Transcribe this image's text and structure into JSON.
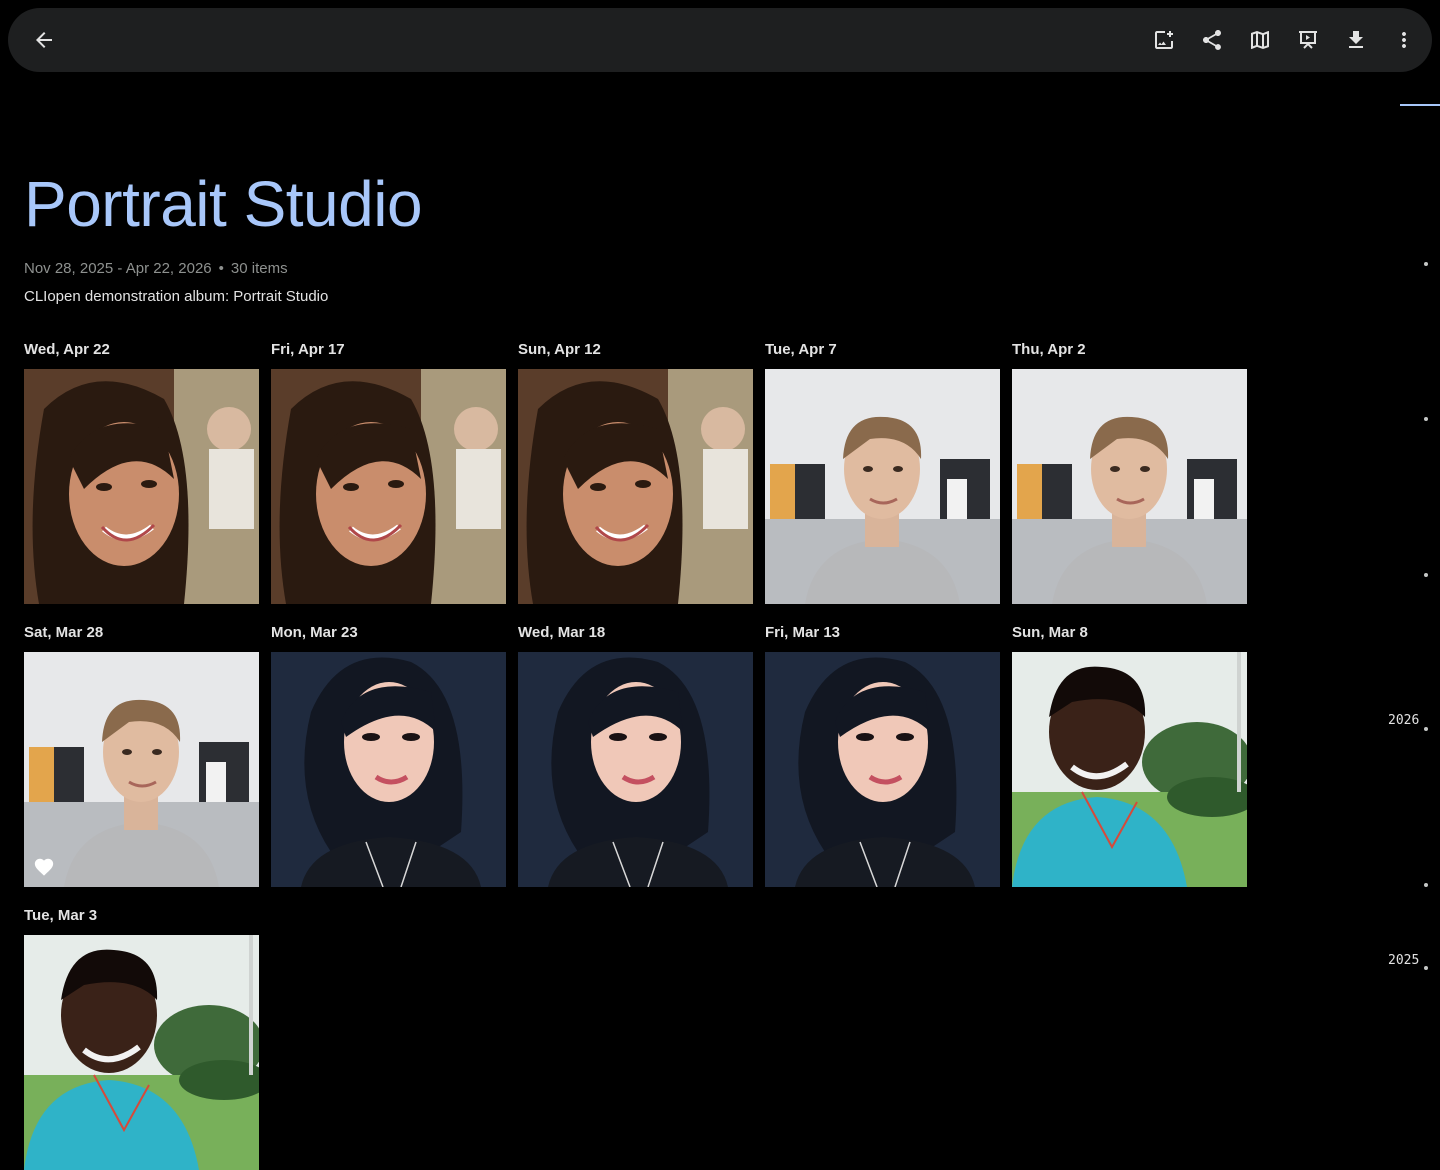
{
  "toolbar": {
    "back_icon": "arrow-back-icon",
    "actions": [
      {
        "name": "add-photos-button",
        "icon": "add-photo-icon"
      },
      {
        "name": "share-button",
        "icon": "share-icon"
      },
      {
        "name": "map-button",
        "icon": "map-icon"
      },
      {
        "name": "slideshow-button",
        "icon": "slideshow-icon"
      },
      {
        "name": "download-button",
        "icon": "download-icon"
      },
      {
        "name": "more-options-button",
        "icon": "more-vert-icon"
      }
    ]
  },
  "album": {
    "title": "Portrait Studio",
    "date_range": "Nov 28, 2025 - Apr 22, 2026",
    "separator": "•",
    "item_count": "30 items",
    "description": "CLIopen demonstration album: Portrait Studio"
  },
  "photos": [
    {
      "date": "Wed, Apr 22",
      "subject": "woman-long-hair",
      "favorite": false
    },
    {
      "date": "Fri, Apr 17",
      "subject": "woman-long-hair",
      "favorite": false
    },
    {
      "date": "Sun, Apr 12",
      "subject": "woman-long-hair",
      "favorite": false
    },
    {
      "date": "Tue, Apr 7",
      "subject": "man-boathouses",
      "favorite": false
    },
    {
      "date": "Thu, Apr 2",
      "subject": "man-boathouses",
      "favorite": false
    },
    {
      "date": "Sat, Mar 28",
      "subject": "man-boathouses",
      "favorite": true
    },
    {
      "date": "Mon, Mar 23",
      "subject": "woman-dark-bob",
      "favorite": false
    },
    {
      "date": "Wed, Mar 18",
      "subject": "woman-dark-bob",
      "favorite": false
    },
    {
      "date": "Fri, Mar 13",
      "subject": "woman-dark-bob",
      "favorite": false
    },
    {
      "date": "Sun, Mar 8",
      "subject": "man-outdoor-teal-shirt",
      "favorite": false
    },
    {
      "date": "Tue, Mar 3",
      "subject": "man-outdoor-teal-shirt",
      "favorite": false
    }
  ],
  "timeline": {
    "years": [
      "2026",
      "2025"
    ]
  },
  "colors": {
    "accent": "#a8c7fa",
    "toolbar_bg": "#1e1f20",
    "page_bg": "#000000"
  }
}
